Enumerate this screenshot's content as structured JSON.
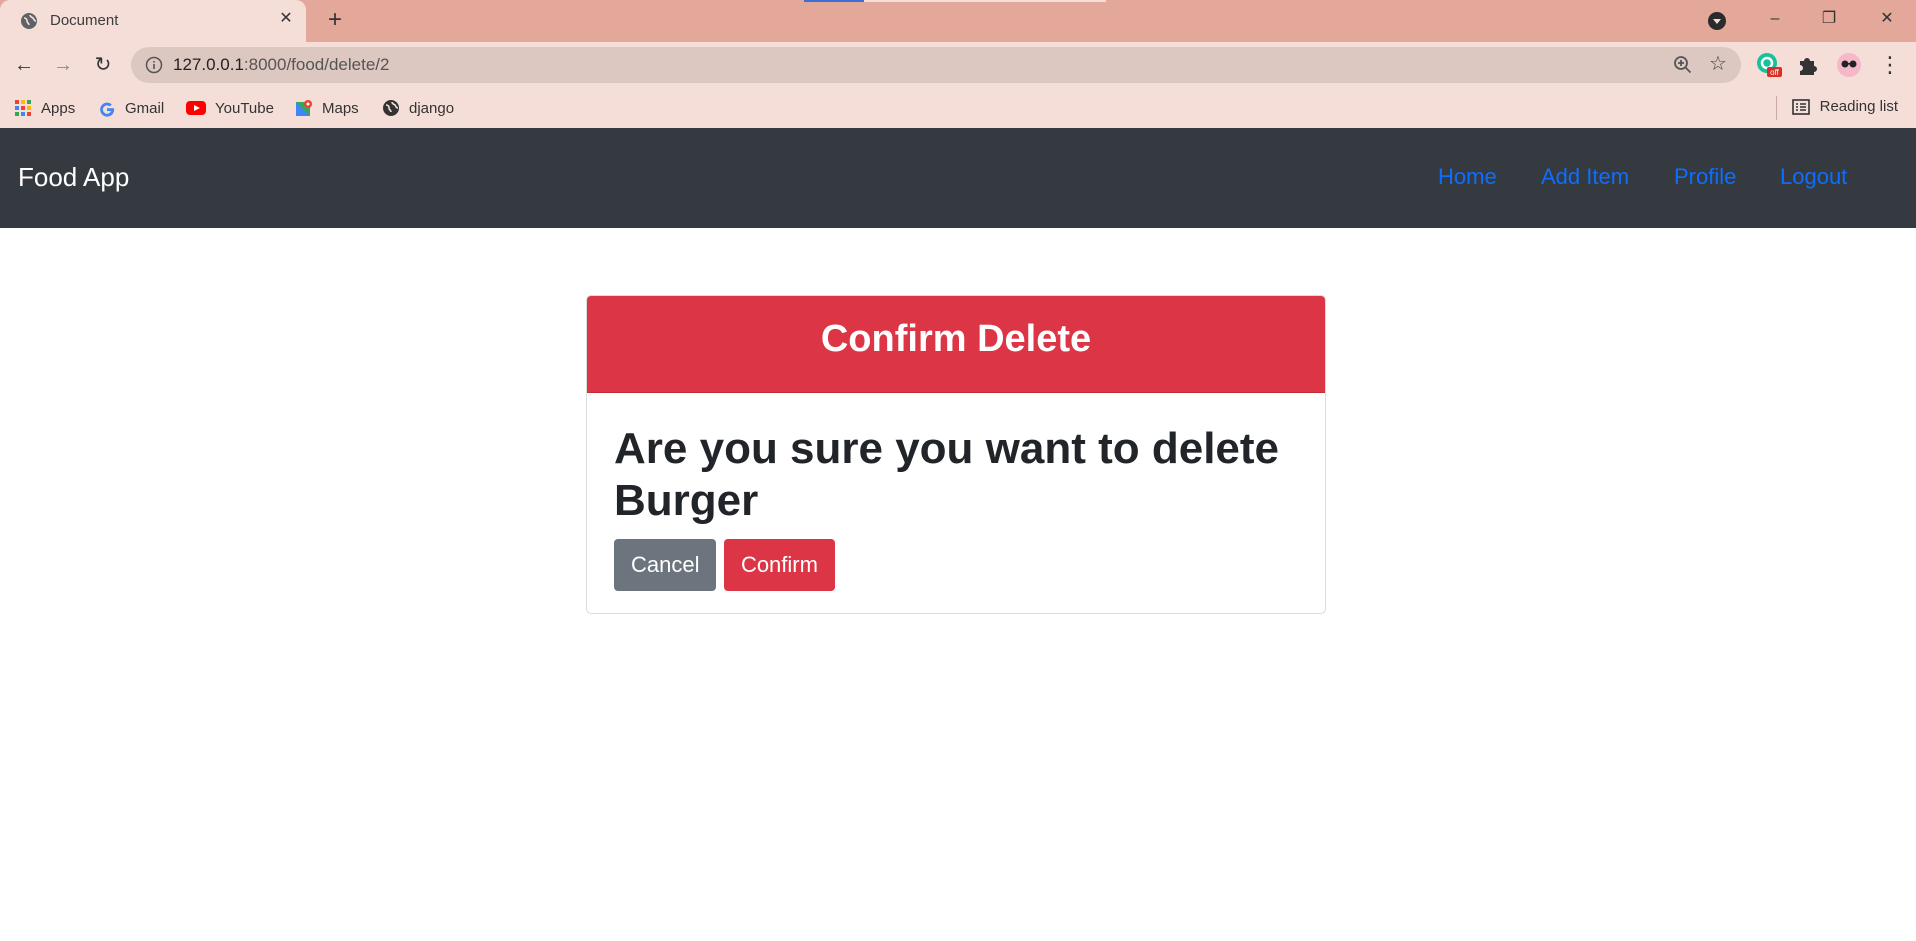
{
  "browser": {
    "tab_title": "Document",
    "tab_close": "✕",
    "new_tab": "+",
    "url_host": "127.0.0.1",
    "url_rest": ":8000/food/delete/2",
    "bookmarks": [
      {
        "label": "Apps",
        "icon": "apps-grid-icon"
      },
      {
        "label": "Gmail",
        "icon": "google-icon"
      },
      {
        "label": "YouTube",
        "icon": "youtube-icon"
      },
      {
        "label": "Maps",
        "icon": "maps-icon"
      },
      {
        "label": "django",
        "icon": "globe-icon"
      }
    ],
    "reading_list": "Reading list",
    "extension_badge": "off",
    "window_controls": {
      "minimize": "–",
      "restore": "❐",
      "close": "✕"
    }
  },
  "navbar": {
    "brand": "Food App",
    "links": [
      "Home",
      "Add Item",
      "Profile",
      "Logout"
    ],
    "background": "#343a40",
    "link_color": "#0d6efd"
  },
  "card": {
    "header": "Confirm Delete",
    "question": "Are you sure you want to delete Burger",
    "cancel_label": "Cancel",
    "confirm_label": "Confirm",
    "accent": "#dc3545",
    "secondary": "#6c757d"
  }
}
